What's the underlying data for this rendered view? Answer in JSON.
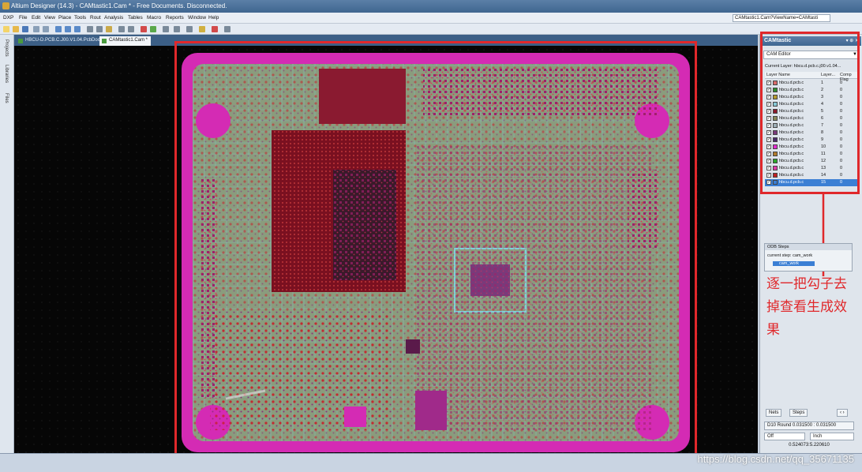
{
  "window": {
    "title": "Altium Designer (14.3) - CAMtastic1.Cam * - Free Documents. Disconnected."
  },
  "menu": {
    "items": [
      "DXP",
      "File",
      "Edit",
      "View",
      "Place",
      "Tools",
      "Rout",
      "Analysis",
      "Tables",
      "Macro",
      "Reports",
      "Window",
      "Help"
    ],
    "path": "CAMtastic1.Cam?ViewName=CAMtasti"
  },
  "left_strip": [
    "Projects",
    "Libraries",
    "Files"
  ],
  "doc_tabs": [
    "HBCU-D.PCB.C.J00.V1.04.PcbDoc",
    "CAMtastic1.Cam *"
  ],
  "panel": {
    "title": "CAMtastic",
    "mode": "CAM Editor",
    "current_layer": "Current Layer: hbcu.d.pcb.c.j00.v1.04...",
    "columns": [
      "Layer Name",
      "Layer...",
      "Comp Flag"
    ],
    "layers": [
      {
        "name": "hbcu.d.pcb.c",
        "num": "1",
        "flag": "0",
        "color": "#d86a6a"
      },
      {
        "name": "hbcu.d.pcb.c",
        "num": "2",
        "flag": "0",
        "color": "#2f8f2f"
      },
      {
        "name": "hbcu.d.pcb.c",
        "num": "3",
        "flag": "0",
        "color": "#b59a2c"
      },
      {
        "name": "hbcu.d.pcb.c",
        "num": "4",
        "flag": "0",
        "color": "#87c9d6"
      },
      {
        "name": "hbcu.d.pcb.c",
        "num": "5",
        "flag": "0",
        "color": "#8b1a2a"
      },
      {
        "name": "hbcu.d.pcb.c",
        "num": "6",
        "flag": "0",
        "color": "#8a8a5a"
      },
      {
        "name": "hbcu.d.pcb.c",
        "num": "7",
        "flag": "0",
        "color": "#9fb0b8"
      },
      {
        "name": "hbcu.d.pcb.c",
        "num": "8",
        "flag": "0",
        "color": "#7a3a7a"
      },
      {
        "name": "hbcu.d.pcb.c",
        "num": "9",
        "flag": "0",
        "color": "#4a2a6a"
      },
      {
        "name": "hbcu.d.pcb.c",
        "num": "10",
        "flag": "0",
        "color": "#e22ad0"
      },
      {
        "name": "hbcu.d.pcb.c",
        "num": "11",
        "flag": "0",
        "color": "#b07a2a"
      },
      {
        "name": "hbcu.d.pcb.c",
        "num": "12",
        "flag": "0",
        "color": "#2aa82a"
      },
      {
        "name": "hbcu.d.pcb.c",
        "num": "13",
        "flag": "0",
        "color": "#e03aa8"
      },
      {
        "name": "hbcu.d.pcb.c",
        "num": "14",
        "flag": "0",
        "color": "#c02020"
      },
      {
        "name": "hbcu.d.pcb.c",
        "num": "15",
        "flag": "0",
        "color": "#3b7fd4"
      }
    ]
  },
  "odb": {
    "header": "ODB Steps",
    "current_step": "current step: cam_work",
    "item": "cam_work"
  },
  "annotation": "逐一把勾子去掉查看生成效果",
  "nav": {
    "nets": "Nets",
    "steps": "Steps"
  },
  "status": {
    "dcode": "D10  Round  0.031500 : 0.031500",
    "mode": "Off",
    "unit": "Inch",
    "coords": "0.524073:5.220610"
  },
  "watermark": "https://blog.csdn.net/qq_35671135",
  "colors": {
    "accent_red": "#e0282b",
    "board_magenta": "#d42bb4",
    "board_green": "#8a9c7d"
  }
}
